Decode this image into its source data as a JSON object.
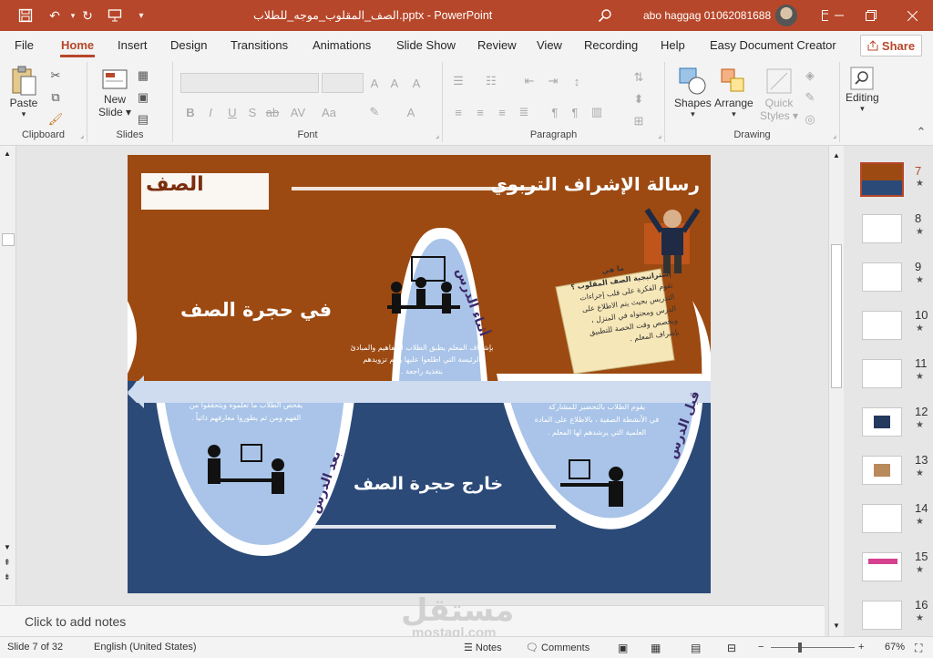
{
  "window": {
    "title": "الصف_المقلوب_موجه_للطلاب.pptx  -  PowerPoint",
    "user": "abo haggag 01062081688"
  },
  "menu": {
    "tabs": [
      "File",
      "Home",
      "Insert",
      "Design",
      "Transitions",
      "Animations",
      "Slide Show",
      "Review",
      "View",
      "Recording",
      "Help",
      "Easy Document Creator"
    ],
    "active": "Home",
    "share": "Share"
  },
  "ribbon": {
    "clipboard": {
      "paste": "Paste",
      "label": "Clipboard"
    },
    "slides": {
      "new_slide_1": "New",
      "new_slide_2": "Slide",
      "label": "Slides"
    },
    "font": {
      "label": "Font"
    },
    "paragraph": {
      "label": "Paragraph"
    },
    "drawing": {
      "shapes": "Shapes",
      "arrange": "Arrange",
      "quick_styles_1": "Quick",
      "quick_styles_2": "Styles",
      "label": "Drawing"
    },
    "editing": {
      "label": "Editing"
    }
  },
  "slide": {
    "header": "رسالة الإشراف التربوي",
    "logo": "الصف",
    "in_class": "في حجرة الصف",
    "out_class": "خارج حجرة الصف",
    "during": "أثناء الدرس",
    "before": "قبل الدرس",
    "after": "بعد الدرس",
    "what_is_title": "ما هي",
    "what_is_1": "إستراتيجية الصف المقلوب ؟",
    "what_is_2": "تقوم الفكرة على قلب إجراءات",
    "what_is_3": "التدريس بحيث يتم الاطلاع على",
    "what_is_4": "الدرس ومحتواه في المنزل ،",
    "what_is_5": "ويخصص وقت الحصة للتطبيق",
    "what_is_6": "بإشراف المعلم .",
    "during_text_1": "بإشراف المعلم يطبق الطلاب المفاهيم والمبادئ",
    "during_text_2": "الرئيسة التي اطلعوا عليها ويتم تزويدهم",
    "during_text_3": "بتغذية راجعة .",
    "before_text_1": "يقوم الطلاب بالتحضير للمشاركة",
    "before_text_2": "في الأنشطة الصفية ، بالاطلاع على المادة",
    "before_text_3": "العلمية التي يرشدهم لها المعلم .",
    "after_text_1": "يفحص الطلاب ما تعلموه ويتحققوا من",
    "after_text_2": "الفهم ومن ثم يطوروا معارفهم ذاتياً ."
  },
  "notes": {
    "placeholder": "Click to add notes"
  },
  "thumbnails": {
    "numbers": [
      "7",
      "8",
      "9",
      "10",
      "11",
      "12",
      "13",
      "14",
      "15",
      "16"
    ],
    "active": "7"
  },
  "status": {
    "slide": "Slide 7 of 32",
    "language": "English (United States)",
    "notes": "Notes",
    "comments": "Comments",
    "zoom": "67%"
  },
  "watermark": {
    "arabic": "مستقل",
    "latin": "mostaql.com"
  },
  "colors": {
    "accent": "#b7472a",
    "slide_top": "#9c4a12",
    "slide_bottom": "#2b4a78",
    "bubble": "#a9c4e8"
  }
}
